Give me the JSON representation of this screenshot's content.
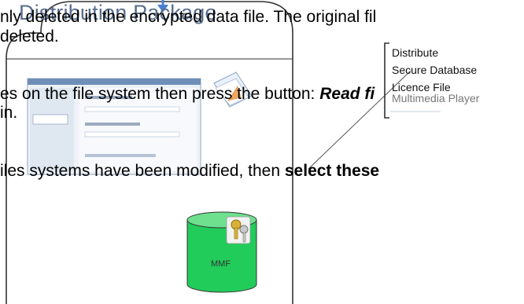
{
  "package": {
    "title": "Distribution Package",
    "cylinder_label": "MMF",
    "menu_items": [
      "Distribute",
      "Secure Database",
      "Licence File",
      "Multimedia Player"
    ]
  },
  "text": {
    "line1": "nly deleted in the encrypted data file. The original fil",
    "line2": "deleted.",
    "line3a": "es on the file system then press the button: ",
    "line3b": "Read fi",
    "line4": "in.",
    "line5a": "iles systems have been modified, then ",
    "line5b": "select these"
  },
  "colors": {
    "cylinder": "#22cc5a",
    "outline": "#333333",
    "arrow": "#4a7fd4",
    "title": "#5a6f8f"
  }
}
